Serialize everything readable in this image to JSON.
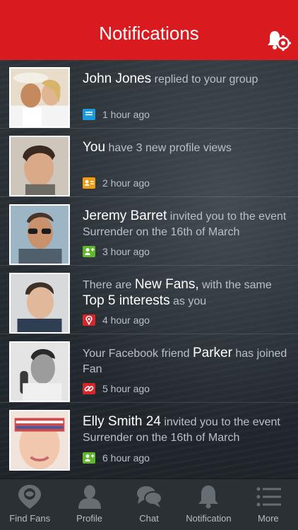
{
  "header": {
    "title": "Notifications",
    "settings_icon": "bell-gear-icon"
  },
  "colors": {
    "brand_red": "#d91a1f",
    "badge_blue": "#1a9be0",
    "badge_orange": "#f29b10",
    "badge_green": "#5fb82c",
    "badge_red": "#d9252a"
  },
  "notifications": [
    {
      "name": "John Jones",
      "action": " replied to your group",
      "icon": "message-icon",
      "time": "1 hour ago"
    },
    {
      "name": "You",
      "action": " have 3 new profile views",
      "icon": "profile-card-icon",
      "time": "2 hour ago"
    },
    {
      "name": "Jeremy Barret",
      "action": " invited you to the event Surrender on the 16th of March",
      "icon": "add-user-icon",
      "time": "3 hour ago"
    },
    {
      "prefix": "There are ",
      "name": "New Fans,",
      "action": " with the same ",
      "name2": "Top 5 interests",
      "suffix": " as you",
      "icon": "fans-icon",
      "time": "4 hour ago"
    },
    {
      "prefix": "Your Facebook friend ",
      "name": "Parker",
      "action": " has joined Fan",
      "icon": "link-icon",
      "time": "5 hour ago"
    },
    {
      "name": "Elly Smith 24",
      "action": " invited you to the event Surrender on the 16th of March",
      "icon": "add-user-icon",
      "time": "6 hour ago"
    }
  ],
  "tabs": [
    {
      "label": "Find Fans",
      "icon": "location-pin-icon"
    },
    {
      "label": "Profile",
      "icon": "person-icon"
    },
    {
      "label": "Chat",
      "icon": "chat-bubbles-icon"
    },
    {
      "label": "Notification",
      "icon": "bell-icon"
    },
    {
      "label": "More",
      "icon": "menu-list-icon"
    }
  ]
}
